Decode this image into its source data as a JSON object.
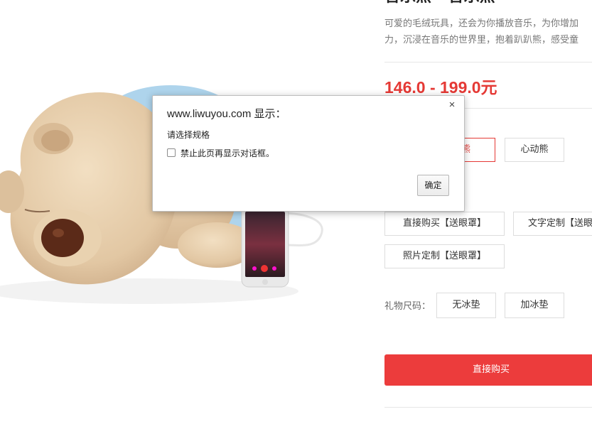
{
  "product": {
    "title_partial": "音乐熊 · 音乐熊",
    "description_lines": [
      "可爱的毛绒玩具，还会为你播放音乐，为你增加",
      "力，沉浸在音乐的世界里，抱着趴趴熊，感受童"
    ],
    "price": "146.0 - 199.0元"
  },
  "style_options": [
    "皮熊",
    "心动熊"
  ],
  "purchase_options": [
    "直接购买【送眼罩】",
    "文字定制【送眼",
    "照片定制【送眼罩】"
  ],
  "gift_size": {
    "label": "礼物尺码：",
    "options": [
      "无冰垫",
      "加冰垫"
    ]
  },
  "buy_button": "直接购买",
  "dialog": {
    "title": "www.liwuyou.com 显示：",
    "message": "请选择规格",
    "checkbox_label": "禁止此页再显示对话框。",
    "ok_label": "确定",
    "close_symbol": "×"
  },
  "colors": {
    "accent_red": "#e53935",
    "button_red": "#ec3c3c"
  }
}
